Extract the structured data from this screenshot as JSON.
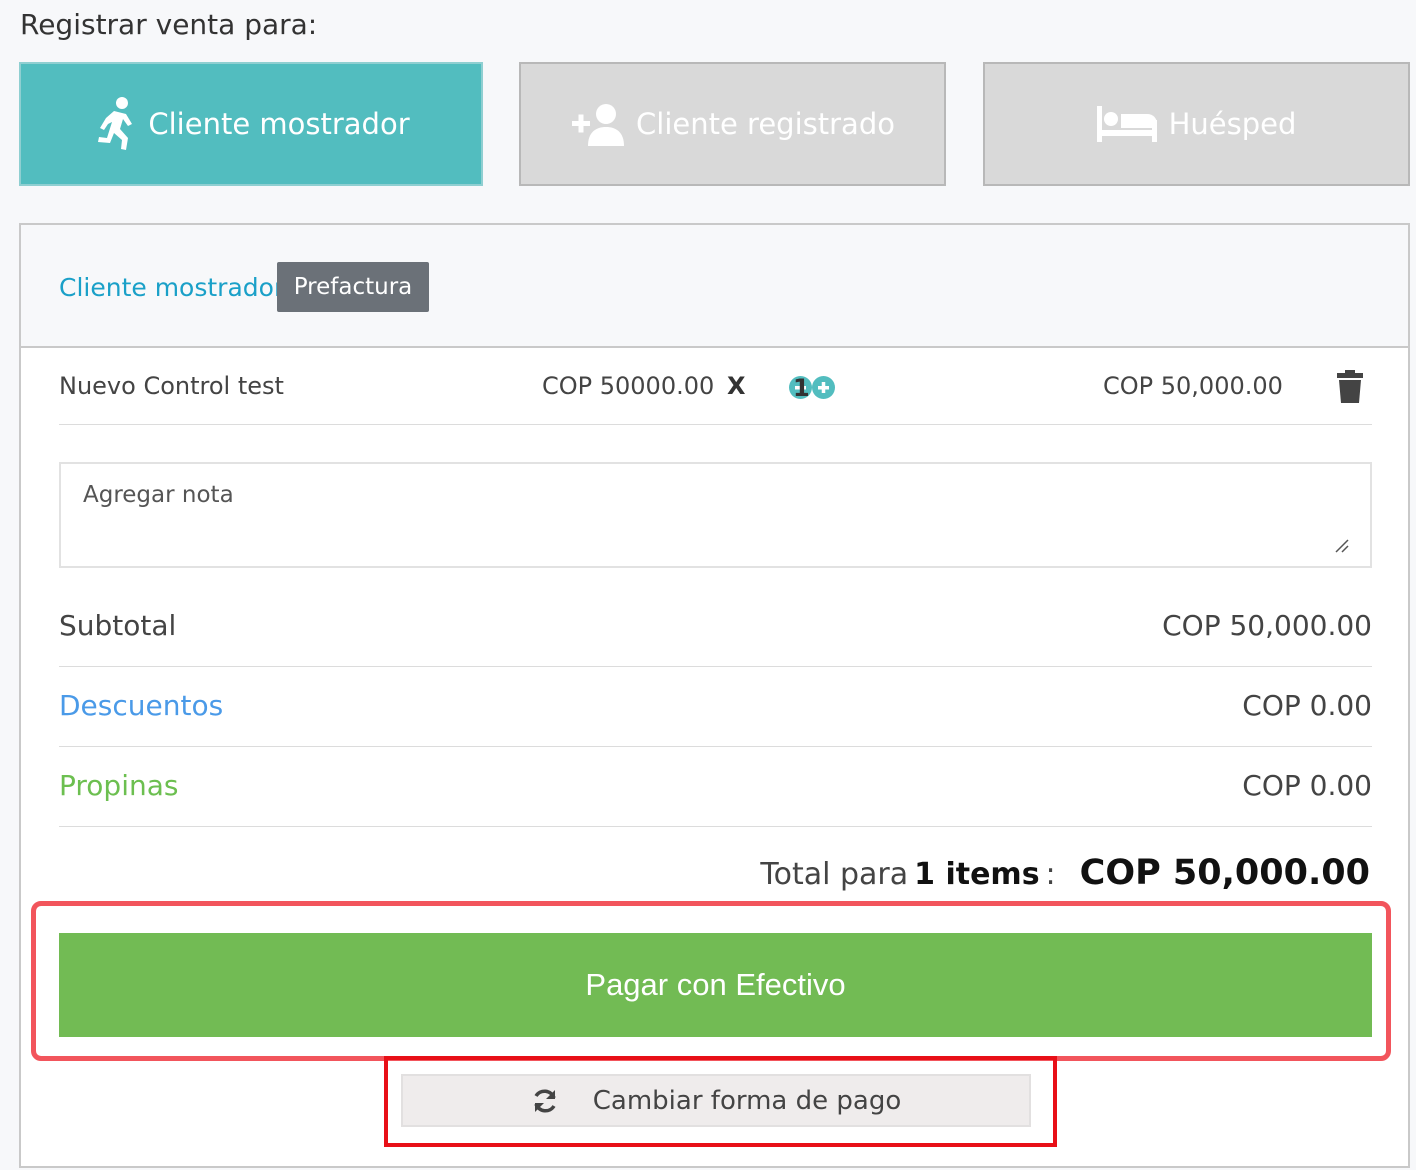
{
  "header": {
    "label": "Registrar venta para:"
  },
  "customer_types": [
    {
      "label": "Cliente mostrador",
      "icon": "running-person-icon",
      "active": true
    },
    {
      "label": "Cliente registrado",
      "icon": "add-user-icon",
      "active": false
    },
    {
      "label": "Huésped",
      "icon": "bed-icon",
      "active": false
    }
  ],
  "panel": {
    "client_label": "Cliente mostrador",
    "prefactura_label": "Prefactura"
  },
  "item": {
    "name": "Nuevo Control test",
    "unit_price": "COP 50000.00",
    "multiplier": "X",
    "quantity": "1",
    "line_total": "COP 50,000.00"
  },
  "note": {
    "placeholder": "Agregar nota"
  },
  "summary": {
    "subtotal_label": "Subtotal",
    "subtotal_value": "COP 50,000.00",
    "discounts_label": "Descuentos",
    "discounts_value": "COP 0.00",
    "tips_label": "Propinas",
    "tips_value": "COP 0.00"
  },
  "total": {
    "prefix": "Total para",
    "count": "1 items",
    "suffix": ":",
    "amount": "COP 50,000.00"
  },
  "actions": {
    "pay_label": "Pagar con Efectivo",
    "change_label": "Cambiar forma de pago"
  },
  "colors": {
    "accent_teal": "#52bdbf",
    "pay_green": "#72bb54",
    "discount_blue": "#4a9ae8",
    "tips_green": "#6cbf50",
    "highlight_red": "#e80f17"
  }
}
